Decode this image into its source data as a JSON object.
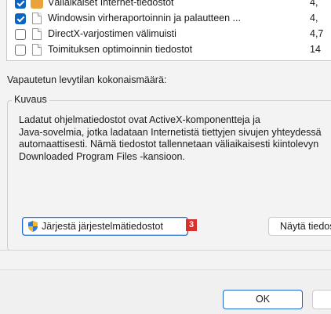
{
  "files_list": {
    "items": [
      {
        "label": "Väliaikaiset Internet-tiedostot",
        "size": "4,",
        "checked": true,
        "icon": "lock-folder-icon"
      },
      {
        "label": "Windowsin virheraportoinnin ja palautteen ...",
        "size": "4,",
        "checked": true,
        "icon": "file-icon"
      },
      {
        "label": "DirectX-varjostimen välimuisti",
        "size": "4,7",
        "checked": false,
        "icon": "file-icon"
      },
      {
        "label": "Toimituksen optimoinnin tiedostot",
        "size": "14",
        "checked": false,
        "icon": "file-icon"
      }
    ]
  },
  "total_label": "Vapautetun levytilan kokonaismäärä:",
  "description": {
    "legend": "Kuvaus",
    "text": "Ladatut ohjelmatiedostot ovat ActiveX-komponentteja ja\nJava-sovelmia, jotka ladataan Internetistä tiettyjen sivujen yhteydessä\nautomaattisesti. Nämä tiedostot tallennetaan väliaikaisesti kiintolevyn\nDownloaded Program Files -kansioon."
  },
  "buttons": {
    "cleanup_system": "Järjestä järjestelmätiedostot",
    "cleanup_badge": "3",
    "view_files": "Näytä tiedostot",
    "ok": "OK",
    "cancel": ""
  },
  "colors": {
    "accent": "#0a64c6",
    "badge": "#d8302b"
  }
}
